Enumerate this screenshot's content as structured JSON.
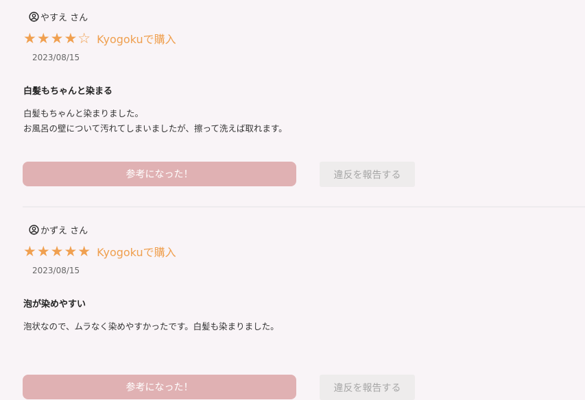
{
  "colors": {
    "background": "#f9f4f7",
    "star": "#f0a050",
    "vendor": "#ef9f4e",
    "helpful_button": "#e0b1b3",
    "report_button": "#eeecec"
  },
  "reviews": [
    {
      "user": "やすえ さん",
      "user_icon": "user-circle-icon",
      "stars": "★★★★☆",
      "rating": 4,
      "vendor": "Kyogokuで購入",
      "date": "2023/08/15",
      "title": "白髪もちゃんと染まる",
      "body": [
        "白髪もちゃんと染まりました。",
        "お風呂の壁について汚れてしまいましたが、擦って洗えば取れます。"
      ],
      "helpful_label": "参考になった！",
      "report_label": "違反を報告する"
    },
    {
      "user": "かずえ さん",
      "user_icon": "user-circle-icon",
      "stars": "★★★★★",
      "rating": 5,
      "vendor": "Kyogokuで購入",
      "date": "2023/08/15",
      "title": "泡が染めやすい",
      "body": [
        "泡状なので、ムラなく染めやすかったです。白髪も染まりました。"
      ],
      "helpful_label": "参考になった！",
      "report_label": "違反を報告する"
    }
  ]
}
